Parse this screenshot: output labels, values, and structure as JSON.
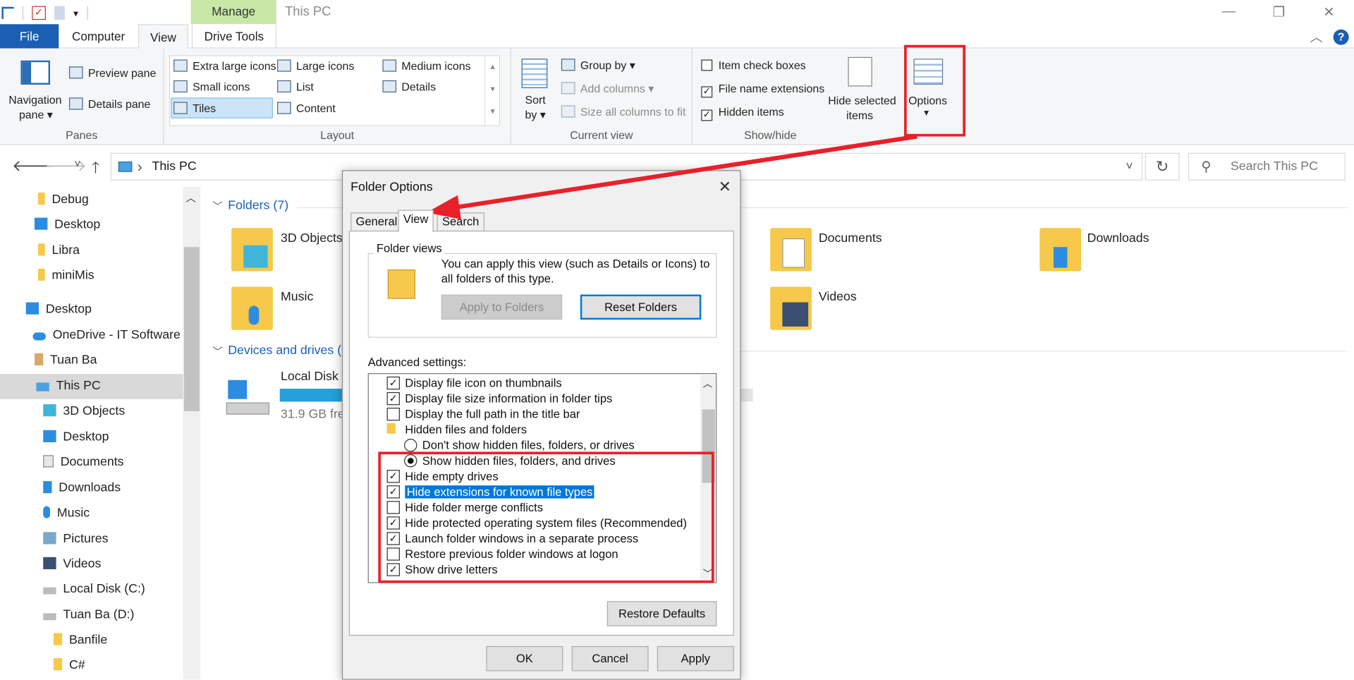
{
  "window": {
    "title": "This PC",
    "manage_label": "Manage",
    "minimize": "—",
    "maximize": "❐",
    "close": "✕"
  },
  "tabs": {
    "file": "File",
    "computer": "Computer",
    "view": "View",
    "drive_tools": "Drive Tools",
    "help": "?",
    "collapse": "︿"
  },
  "ribbon": {
    "panes": {
      "label": "Panes",
      "navigation_pane": "Navigation",
      "navigation_pane_2": "pane ▾",
      "preview_pane": "Preview pane",
      "details_pane": "Details pane"
    },
    "layout": {
      "label": "Layout",
      "items": [
        "Extra large icons",
        "Large icons",
        "Medium icons",
        "Small icons",
        "List",
        "Details",
        "Tiles",
        "Content"
      ]
    },
    "current_view": {
      "label": "Current view",
      "sort_by": "Sort",
      "sort_by_2": "by ▾",
      "group_by": "Group by ▾",
      "add_columns": "Add columns ▾",
      "size_all": "Size all columns to fit"
    },
    "show_hide": {
      "label": "Show/hide",
      "item_check_boxes": "Item check boxes",
      "file_name_extensions": "File name extensions",
      "hidden_items": "Hidden items",
      "hide_selected": "Hide selected",
      "hide_selected_2": "items",
      "options": "Options",
      "options_arrow": "▾"
    }
  },
  "address": {
    "back": "🡐",
    "forward": "🡒",
    "recent": "˅",
    "up": "🡑",
    "path": "This PC",
    "sep": "›",
    "dropdown": "˅",
    "refresh": "↻",
    "search_placeholder": "Search This PC",
    "search_icon": "⚲"
  },
  "nav": {
    "items": [
      "Debug",
      "Desktop",
      "Libra",
      "miniMis",
      "Desktop",
      "OneDrive - IT Software",
      "Tuan Ba",
      "This PC",
      "3D Objects",
      "Desktop",
      "Documents",
      "Downloads",
      "Music",
      "Pictures",
      "Videos",
      "Local Disk (C:)",
      "Tuan Ba (D:)",
      "Banfile",
      "C#"
    ]
  },
  "content": {
    "folders_header": "Folders (7)",
    "devices_header": "Devices and drives (2",
    "folders": [
      "3D Objects",
      "Documents",
      "Downloads",
      "Music",
      "Videos"
    ],
    "drive_name": "Local Disk (",
    "drive_free": "31.9 GB fre",
    "drive_fill": 0.9
  },
  "dialog": {
    "title": "Folder Options",
    "close": "✕",
    "tabs": [
      "General",
      "View",
      "Search"
    ],
    "folder_views_label": "Folder views",
    "folder_views_text_1": "You can apply this view (such as Details or Icons) to",
    "folder_views_text_2": "all folders of this type.",
    "apply_to_folders": "Apply to Folders",
    "reset_folders": "Reset Folders",
    "advanced_label": "Advanced settings:",
    "settings": [
      {
        "label": "Display file icon on thumbnails",
        "type": "checkbox",
        "checked": true
      },
      {
        "label": "Display file size information in folder tips",
        "type": "checkbox",
        "checked": true
      },
      {
        "label": "Display the full path in the title bar",
        "type": "checkbox",
        "checked": false
      },
      {
        "label": "Hidden files and folders",
        "type": "folder"
      },
      {
        "label": "Don't show hidden files, folders, or drives",
        "type": "radio",
        "checked": false
      },
      {
        "label": "Show hidden files, folders, and drives",
        "type": "radio",
        "checked": true
      },
      {
        "label": "Hide empty drives",
        "type": "checkbox",
        "checked": true
      },
      {
        "label": "Hide extensions for known file types",
        "type": "checkbox",
        "checked": true,
        "highlighted": true
      },
      {
        "label": "Hide folder merge conflicts",
        "type": "checkbox",
        "checked": false
      },
      {
        "label": "Hide protected operating system files (Recommended)",
        "type": "checkbox",
        "checked": true
      },
      {
        "label": "Launch folder windows in a separate process",
        "type": "checkbox",
        "checked": true
      },
      {
        "label": "Restore previous folder windows at logon",
        "type": "checkbox",
        "checked": false
      },
      {
        "label": "Show drive letters",
        "type": "checkbox",
        "checked": true
      }
    ],
    "restore_defaults": "Restore Defaults",
    "ok": "OK",
    "cancel": "Cancel",
    "apply": "Apply"
  },
  "colors": {
    "accent": "#1a5fb4",
    "highlight_red": "#e8202a",
    "selection_blue": "#0078d7",
    "folder_yellow": "#f6c94a"
  }
}
